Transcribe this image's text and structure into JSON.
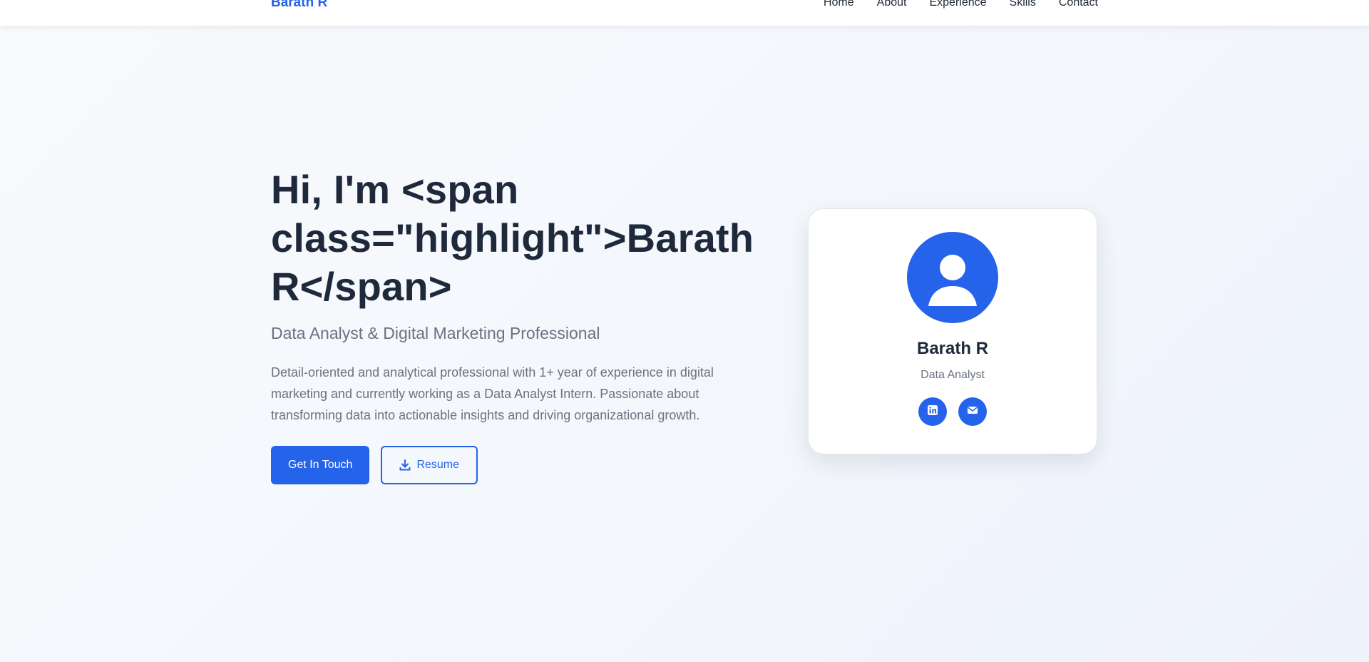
{
  "nav": {
    "logo": "Barath R",
    "links": [
      "Home",
      "About",
      "Experience",
      "Skills",
      "Contact"
    ]
  },
  "hero": {
    "title": "Hi, I'm <span class=\"highlight\">Barath R</span>",
    "subtitle": "Data Analyst & Digital Marketing Professional",
    "description": "Detail-oriented and analytical professional with 1+ year of experience in digital marketing and currently working as a Data Analyst Intern. Passionate about transforming data into actionable insights and driving organizational growth.",
    "primary_button": "Get In Touch",
    "secondary_button": "Resume",
    "secondary_button_icon": "download-icon"
  },
  "profile_card": {
    "name": "Barath R",
    "role": "Data Analyst",
    "avatar_icon": "user-icon",
    "social": [
      {
        "icon": "linkedin-icon"
      },
      {
        "icon": "email-icon"
      }
    ]
  },
  "colors": {
    "accent": "#2563eb",
    "heading": "#1e293b",
    "muted": "#6b7280"
  }
}
